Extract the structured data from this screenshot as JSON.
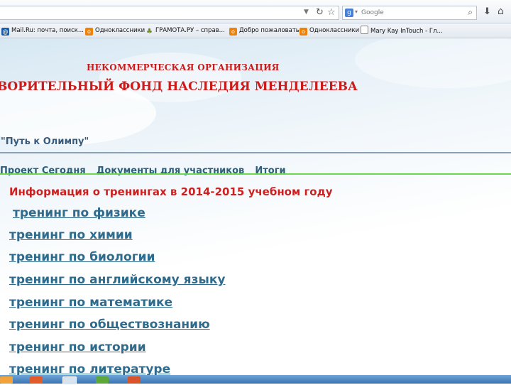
{
  "browser": {
    "search_placeholder": "Google",
    "bookmarks": [
      {
        "label": "Mail.Ru: почта, поиск...",
        "icon": "mail-icon"
      },
      {
        "label": "Одноклассники",
        "icon": "odnoklassniki-icon"
      },
      {
        "label": "ГРАМОТА.РУ – справ...",
        "icon": "gramota-icon"
      },
      {
        "label": "Добро пожаловать",
        "icon": "odnoklassniki-icon"
      },
      {
        "label": "Одноклассники",
        "icon": "odnoklassniki-icon"
      },
      {
        "label": "Mary Kay InTouch - Гл...",
        "icon": "page-icon"
      }
    ]
  },
  "site": {
    "org_line": "НЕКОММЕРЧЕСКАЯ ОРГАНИЗАЦИЯ",
    "fund_title": "ВОРИТЕЛЬНЫЙ ФОНД НАСЛЕДИЯ МЕНДЕЛЕЕВА",
    "program": "\"Путь к Олимпу\"",
    "nav": [
      "Проект Сегодня",
      "Документы для участников",
      "Итоги"
    ],
    "info_heading": "Информация о тренингах в 2014-2015 учебном году",
    "courses": [
      "тренинг по физике",
      "тренинг по химии",
      "тренинг по биологии",
      "тренинг по английскому языку",
      "тренинг по математике",
      "тренинг по обществознанию",
      "тренинг по истории",
      "тренинг по литературе"
    ]
  },
  "colors": {
    "title_red": "#cc1b1b",
    "link_blue": "#2e6b8c",
    "green_rule": "#6cd84f"
  }
}
